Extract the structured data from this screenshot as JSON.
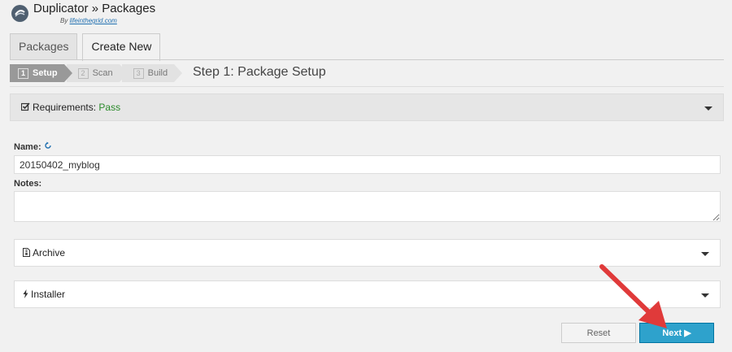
{
  "header": {
    "title": "Duplicator » Packages",
    "by_prefix": "By",
    "by_link": "lifeinthegrid.com",
    "logo_icon": "duplicator-logo-icon"
  },
  "tabs": [
    {
      "label": "Packages",
      "active": false
    },
    {
      "label": "Create New",
      "active": true
    }
  ],
  "steps": [
    {
      "num": "1",
      "label": "Setup",
      "state": "current"
    },
    {
      "num": "2",
      "label": "Scan",
      "state": "pending"
    },
    {
      "num": "3",
      "label": "Build",
      "state": "pending"
    }
  ],
  "step_title": "Step 1: Package Setup",
  "requirements": {
    "label": "Requirements:",
    "status": "Pass",
    "status_color": "#2a8a2a",
    "icon": "checkbox-icon"
  },
  "form": {
    "name_label": "Name:",
    "name_value": "20150402_myblog",
    "reset_name_icon": "refresh-icon",
    "notes_label": "Notes:",
    "notes_value": ""
  },
  "panels": {
    "archive": {
      "label": "Archive",
      "icon": "file-archive-icon"
    },
    "installer": {
      "label": "Installer",
      "icon": "bolt-icon"
    }
  },
  "buttons": {
    "reset_label": "Reset",
    "next_label": "Next ▶"
  },
  "colors": {
    "accent": "#2ea2cc",
    "annotation_arrow": "#e03a3a"
  }
}
